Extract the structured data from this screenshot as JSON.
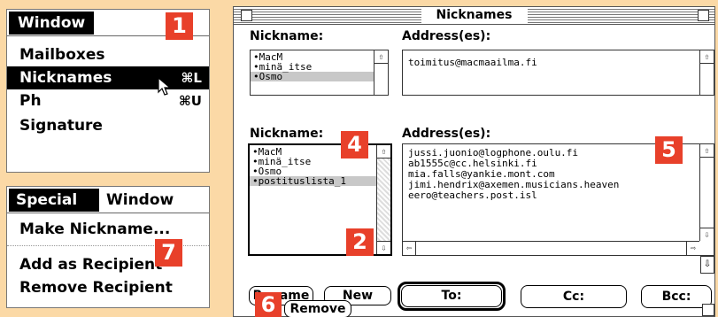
{
  "window_menu": {
    "title": "Window",
    "items": [
      {
        "label": "Mailboxes",
        "shortcut": ""
      },
      {
        "label": "Nicknames",
        "shortcut": "⌘L"
      },
      {
        "label": "Ph",
        "shortcut": "⌘U"
      },
      {
        "label": "Signature",
        "shortcut": ""
      }
    ]
  },
  "special_menu": {
    "titles": [
      "Special",
      "Window"
    ],
    "items": [
      "Make Nickname...",
      "Add as Recipient",
      "Remove Recipient"
    ]
  },
  "badges": [
    "1",
    "2",
    "4",
    "5",
    "6",
    "7"
  ],
  "nicknames_window": {
    "title": "Nicknames",
    "top": {
      "nickname_label": "Nickname:",
      "address_label": "Address(es):",
      "nicknames": [
        "•MacM",
        "•minä_itse",
        "•Osmo"
      ],
      "address": "toimitus@macmaailma.fi"
    },
    "bottom": {
      "nickname_label": "Nickname:",
      "address_label": "Address(es):",
      "nicknames": [
        "•MacM",
        "•minä_itse",
        "•Osmo",
        "•postituslista_1"
      ],
      "addresses": [
        "jussi.juonio@logphone.oulu.fi",
        "ab1555c@cc.helsinki.fi",
        "mia.falls@yankie.mont.com",
        "jimi.hendrix@axemen.musicians.heaven",
        "eero@teachers.post.isl"
      ]
    },
    "buttons": {
      "rename": "Rename",
      "new": "New",
      "remove": "Remove",
      "to": "To:",
      "cc": "Cc:",
      "bcc": "Bcc:"
    }
  }
}
